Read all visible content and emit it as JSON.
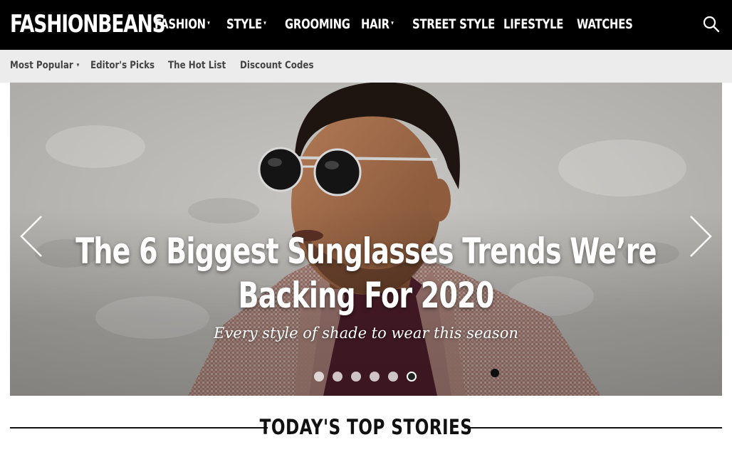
{
  "brand": {
    "logo_text": "FASHIONBEANS"
  },
  "nav": {
    "items": [
      {
        "label": "FASHION",
        "has_dropdown": true
      },
      {
        "label": "STYLE",
        "has_dropdown": true
      },
      {
        "label": "GROOMING",
        "has_dropdown": false
      },
      {
        "label": "HAIR",
        "has_dropdown": true
      },
      {
        "label": "STREET STYLE",
        "has_dropdown": false
      },
      {
        "label": "LIFESTYLE",
        "has_dropdown": false
      },
      {
        "label": "WATCHES",
        "has_dropdown": false
      }
    ],
    "dropdown_glyph": "▾",
    "search_icon": "search-icon"
  },
  "subnav": {
    "items": [
      {
        "label": "Most Popular",
        "has_dropdown": true
      },
      {
        "label": "Editor's Picks",
        "has_dropdown": false
      },
      {
        "label": "The Hot List",
        "has_dropdown": false
      },
      {
        "label": "Discount Codes",
        "has_dropdown": false
      }
    ]
  },
  "hero": {
    "title": "The 6 Biggest Sunglasses Trends We’re Backing For 2020",
    "subtitle": "Every style of shade to wear this season",
    "slide_count": 6,
    "active_slide": 6,
    "prev_icon": "chevron-left-icon",
    "next_icon": "chevron-right-icon"
  },
  "section": {
    "title": "TODAY'S TOP STORIES"
  },
  "colors": {
    "topbar": "#000000",
    "subbar": "#ececec",
    "text_dark": "#111111"
  }
}
